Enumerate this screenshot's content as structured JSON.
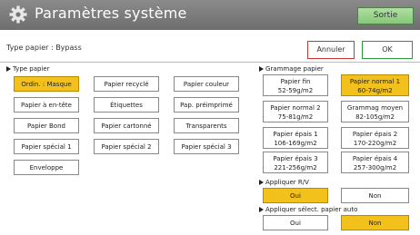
{
  "window": {
    "title": "Paramètres système",
    "exit_label": "Sortie"
  },
  "header": {
    "type_label": "Type papier : Bypass",
    "cancel_label": "Annuler",
    "ok_label": "OK"
  },
  "paper_type": {
    "label": "Type papier",
    "selected": "Ordin. : Masque",
    "options": [
      "Ordin. : Masque",
      "Papier recyclé",
      "Papier couleur",
      "Papier à en-tête",
      "Étiquettes",
      "Pap. préimprimé",
      "Papier Bond",
      "Papier cartonné",
      "Transparents",
      "Papier spécial 1",
      "Papier spécial 2",
      "Papier spécial 3",
      "Enveloppe"
    ]
  },
  "paper_weight": {
    "label": "Grammage papier",
    "selected": "Papier normal 1",
    "options": [
      {
        "name": "Papier fin",
        "range": "52-59g/m2"
      },
      {
        "name": "Papier normal 1",
        "range": "60-74g/m2"
      },
      {
        "name": "Papier normal 2",
        "range": "75-81g/m2"
      },
      {
        "name": "Grammag moyen",
        "range": "82-105g/m2"
      },
      {
        "name": "Papier épais 1",
        "range": "106-169g/m2"
      },
      {
        "name": "Papier épais 2",
        "range": "170-220g/m2"
      },
      {
        "name": "Papier épais 3",
        "range": "221-256g/m2"
      },
      {
        "name": "Papier épais 4",
        "range": "257-300g/m2"
      }
    ]
  },
  "apply_duplex": {
    "label": "Appliquer R/V",
    "yes": "Oui",
    "no": "Non",
    "selected": "Oui"
  },
  "apply_auto_select": {
    "label": "Appliquer sélect. papier auto",
    "yes": "Oui",
    "no": "Non",
    "selected": "Non"
  },
  "colors": {
    "title_bar": "#767676",
    "selected": "#f3c11c",
    "exit_green": "#95d08a",
    "cancel_border": "#cc3333",
    "ok_border": "#2b9a3a"
  }
}
